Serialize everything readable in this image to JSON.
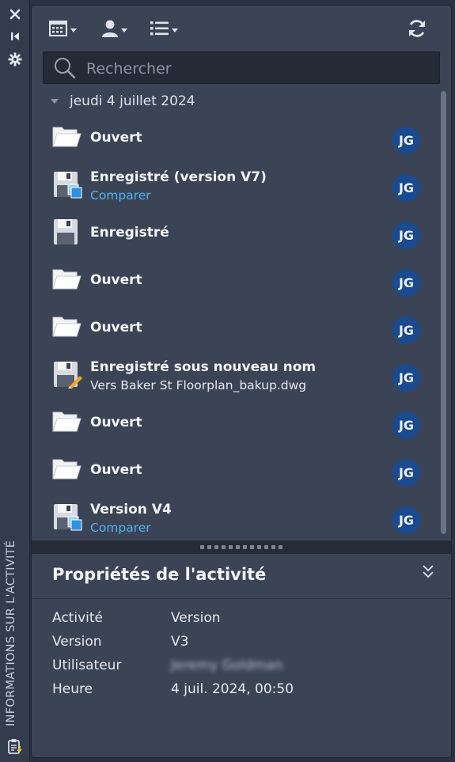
{
  "side_panel": {
    "vertical_title": "INFORMATIONS SUR L'ACTIVITÉ",
    "close_icon": "close-icon",
    "collapse_icon": "skip-back-icon",
    "settings_icon": "gear-icon",
    "bottom_icon": "clipboard-lightning-icon"
  },
  "toolbar": {
    "calendar_icon": "calendar-icon",
    "user_icon": "user-icon",
    "list_icon": "list-icon",
    "refresh_icon": "refresh-icon"
  },
  "search": {
    "placeholder": "Rechercher",
    "value": ""
  },
  "date_group": "jeudi 4 juillet 2024",
  "activities": [
    {
      "icon": "folder-open-icon",
      "title": "Ouvert",
      "subtitle": "",
      "subtitle_type": "",
      "user": "JG"
    },
    {
      "icon": "save-version-icon",
      "title": "Enregistré (version V7)",
      "subtitle": "Comparer",
      "subtitle_type": "link",
      "user": "JG"
    },
    {
      "icon": "save-icon",
      "title": "Enregistré",
      "subtitle": "",
      "subtitle_type": "",
      "user": "JG"
    },
    {
      "icon": "folder-open-icon",
      "title": "Ouvert",
      "subtitle": "",
      "subtitle_type": "",
      "user": "JG"
    },
    {
      "icon": "folder-open-icon",
      "title": "Ouvert",
      "subtitle": "",
      "subtitle_type": "",
      "user": "JG"
    },
    {
      "icon": "save-as-icon",
      "title": "Enregistré sous nouveau nom",
      "subtitle": "Vers Baker St Floorplan_bakup.dwg",
      "subtitle_type": "text",
      "user": "JG"
    },
    {
      "icon": "folder-open-icon",
      "title": "Ouvert",
      "subtitle": "",
      "subtitle_type": "",
      "user": "JG"
    },
    {
      "icon": "folder-open-icon",
      "title": "Ouvert",
      "subtitle": "",
      "subtitle_type": "",
      "user": "JG"
    },
    {
      "icon": "save-version-icon",
      "title": "Version V4",
      "subtitle": "Comparer",
      "subtitle_type": "link",
      "user": "JG"
    }
  ],
  "properties": {
    "title": "Propriétés de l'activité",
    "rows": [
      {
        "label": "Activité",
        "value": "Version"
      },
      {
        "label": "Version",
        "value": "V3"
      },
      {
        "label": "Utilisateur",
        "value": "Jeremy Goldman"
      },
      {
        "label": "Heure",
        "value": "4 juil. 2024, 00:50"
      }
    ]
  },
  "colors": {
    "panel_bg": "#3b4455",
    "strip_bg": "#333c4d",
    "avatar_bg": "#1a4a8f",
    "link": "#4fb3ea"
  }
}
